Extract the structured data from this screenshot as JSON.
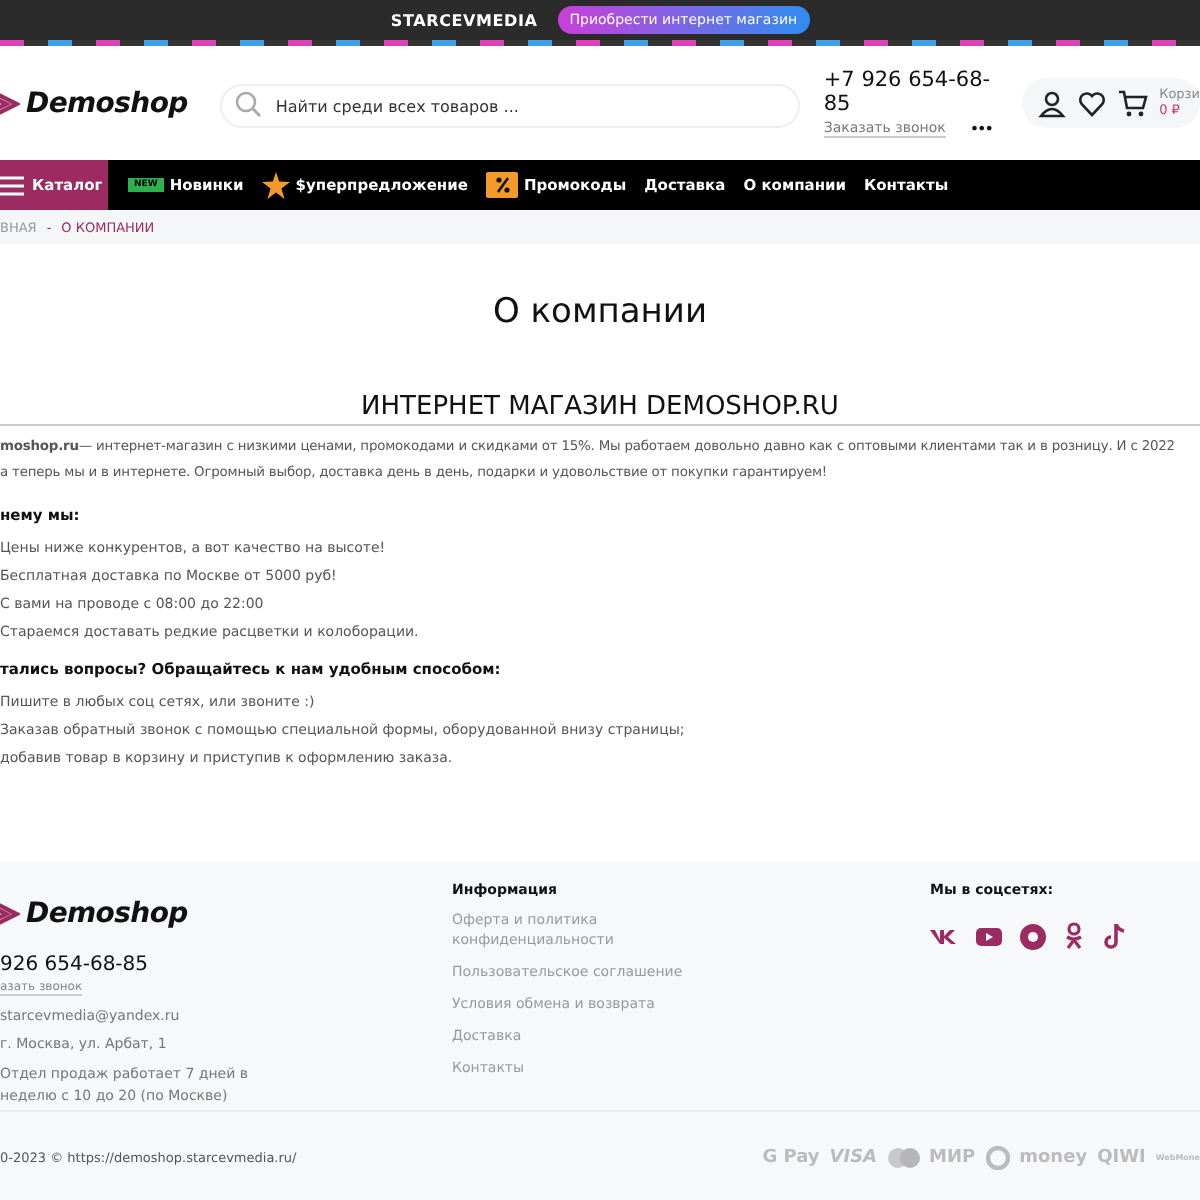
{
  "promo_bar": {
    "brand": "STARCEVMEDIA",
    "button": "Приобрести интернет магазин"
  },
  "header": {
    "logo": "Demoshop",
    "search": {
      "placeholder": "Найти среди всех товаров ..."
    },
    "phone": "+7 926 654-68-85",
    "callback": "Заказать звонок",
    "more": "•••",
    "cart": {
      "label": "Корзи",
      "sum": "0 ₽"
    }
  },
  "nav": {
    "catalog": "Каталог",
    "items": [
      {
        "label": "Новинки",
        "kind": "new",
        "badge": "NEW"
      },
      {
        "label": "$уперпредложение",
        "kind": "star"
      },
      {
        "label": "Промокоды",
        "kind": "coupon"
      },
      {
        "label": "Доставка",
        "kind": "plain"
      },
      {
        "label": "О компании",
        "kind": "plain"
      },
      {
        "label": "Контакты",
        "kind": "plain"
      }
    ]
  },
  "breadcrumb_separator": "-",
  "breadcrumbs": [
    {
      "label": "ВНАЯ",
      "selected": false
    },
    {
      "label": "О КОМПАНИИ",
      "selected": true
    }
  ],
  "page_title": "О компании",
  "article": {
    "heading": "ИНТЕРНЕТ МАГАЗИН DEMOSHOP.RU",
    "intro": [
      "**moshop.ru**— интернет-магазин с низкими ценами, промокодами и скидками от 15%. Мы работаем довольно давно как с оптовыми клиентами так и в розницу. И с 2022",
      "а теперь мы и в интернете. Огромный выбор, доставка день в день, подарки и удовольствие от покупки гарантируем!"
    ],
    "sections": [
      {
        "title": "нему мы:",
        "items": [
          "Цены ниже конкурентов, а вот качество на высоте!",
          "Бесплатная доставка по Москве от 5000 руб!",
          "С вами на проводе с 08:00 до 22:00",
          "Стараемся доставать редкие расцветки и колоборации."
        ]
      },
      {
        "title": "тались вопросы? Обращайтесь к нам удобным способом:",
        "items": [
          "Пишите в любых соц сетях, или звоните :)",
          "Заказав обратный звонок с помощью специальной формы, оборудованной внизу страницы;",
          "добавив товар в корзину и приступив к оформлению заказа."
        ]
      }
    ]
  },
  "footer": {
    "logo": "Demoshop",
    "phone": "926 654-68-85",
    "callback": "азать звонок",
    "email": "starcevmedia@yandex.ru",
    "address": "г. Москва, ул. Арбат, 1",
    "hours": "Отдел продаж работает 7 дней в неделю с 10 до 20 (по Москве)",
    "info_title": "Информация",
    "info_links": [
      "Оферта и политика конфиденциальности",
      "Пользовательское соглашение",
      "Условия обмена и возврата",
      "Доставка",
      "Контакты"
    ],
    "social_title": "Мы в соцсетях:",
    "social": [
      {
        "kind": "vk"
      },
      {
        "kind": "youtube"
      },
      {
        "kind": "circle"
      },
      {
        "kind": "ok"
      },
      {
        "kind": "tiktok"
      }
    ],
    "copyright": "0-2023 © https://demoshop.starcevmedia.ru/",
    "payments": [
      "G Pay",
      "VISA",
      "МИР",
      "money",
      "QIWI",
      "WebMone"
    ]
  }
}
